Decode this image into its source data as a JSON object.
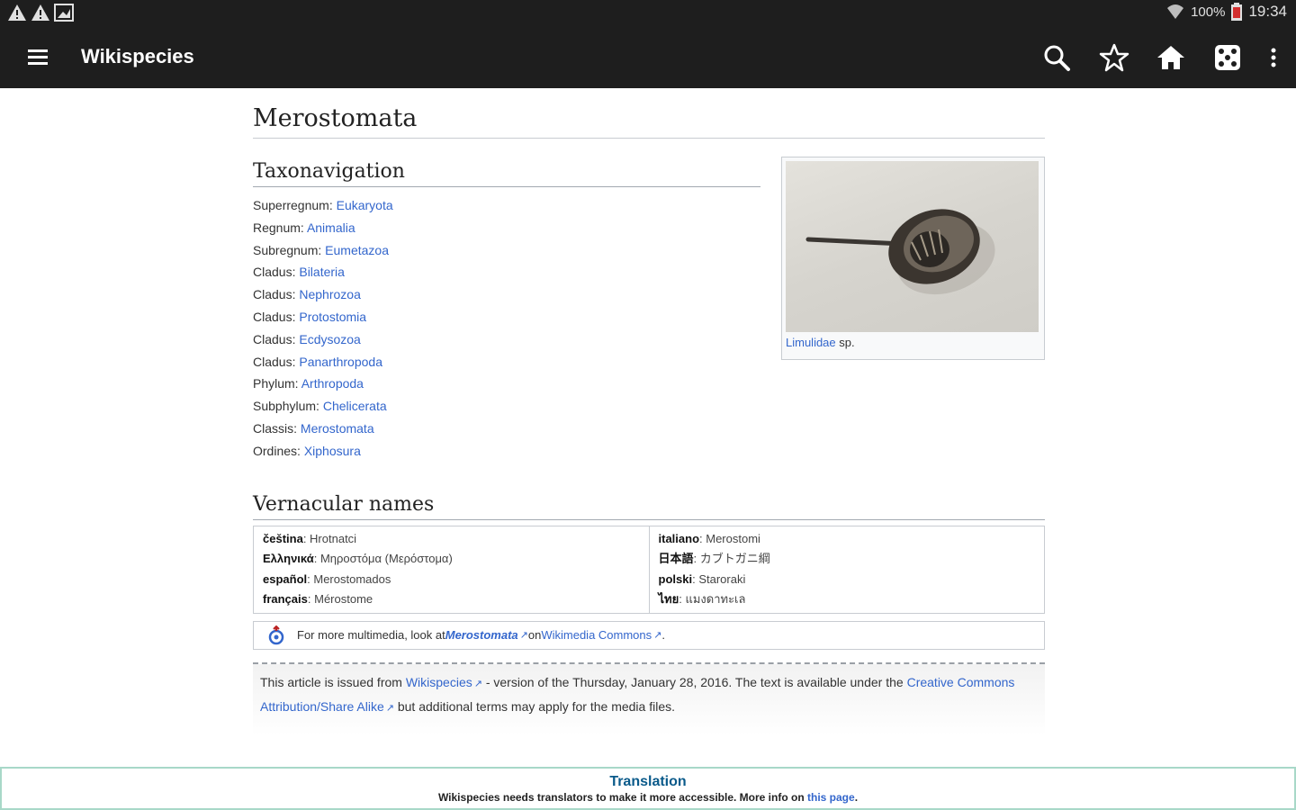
{
  "status_bar": {
    "battery": "100%",
    "time": "19:34"
  },
  "app_bar": {
    "title": "Wikispecies"
  },
  "page": {
    "title": "Merostomata"
  },
  "taxonavigation": {
    "heading": "Taxonavigation",
    "rows": [
      {
        "rank": "Superregnum:",
        "name": "Eukaryota"
      },
      {
        "rank": "Regnum:",
        "name": "Animalia"
      },
      {
        "rank": "Subregnum:",
        "name": "Eumetazoa"
      },
      {
        "rank": "Cladus:",
        "name": "Bilateria"
      },
      {
        "rank": "Cladus:",
        "name": "Nephrozoa"
      },
      {
        "rank": "Cladus:",
        "name": "Protostomia"
      },
      {
        "rank": "Cladus:",
        "name": "Ecdysozoa"
      },
      {
        "rank": "Cladus:",
        "name": "Panarthropoda"
      },
      {
        "rank": "Phylum:",
        "name": "Arthropoda"
      },
      {
        "rank": "Subphylum:",
        "name": "Chelicerata"
      },
      {
        "rank": "Classis:",
        "name": "Merostomata"
      },
      {
        "rank": "Ordines:",
        "name": "Xiphosura"
      }
    ]
  },
  "image": {
    "caption_link": "Limulidae",
    "caption_rest": " sp."
  },
  "vernacular": {
    "heading": "Vernacular names",
    "left": [
      {
        "lang": "čeština",
        "name": "Hrotnatci"
      },
      {
        "lang": "Ελληνικά",
        "name": "Μηροστόμα (Μερόστομα)"
      },
      {
        "lang": "español",
        "name": "Merostomados"
      },
      {
        "lang": "français",
        "name": "Mérostome"
      }
    ],
    "right": [
      {
        "lang": "italiano",
        "name": "Merostomi"
      },
      {
        "lang": "日本語",
        "name": "カブトガニ綱"
      },
      {
        "lang": "polski",
        "name": "Staroraki"
      },
      {
        "lang": "ไทย",
        "name": "แมงดาทะเล"
      }
    ]
  },
  "commons": {
    "prefix": "For more multimedia, look at ",
    "link1": "Merostomata",
    "middle": " on ",
    "link2": "Wikimedia Commons",
    "suffix": "."
  },
  "footer": {
    "p1": "This article is issued from ",
    "link1": "Wikispecies",
    "p2": " - version of the Thursday, January 28, 2016. The text is available under the ",
    "link2": "Creative Commons Attribution/Share Alike",
    "p3": " but additional terms may apply for the media files."
  },
  "banner": {
    "title": "Translation",
    "text": "Wikispecies needs translators to make it more accessible. More info on ",
    "link": "this page",
    "end": "."
  },
  "colors": {
    "app_bar": "#1e1e1e",
    "link": "#3366cc",
    "banner_border": "#a8d8c8"
  }
}
